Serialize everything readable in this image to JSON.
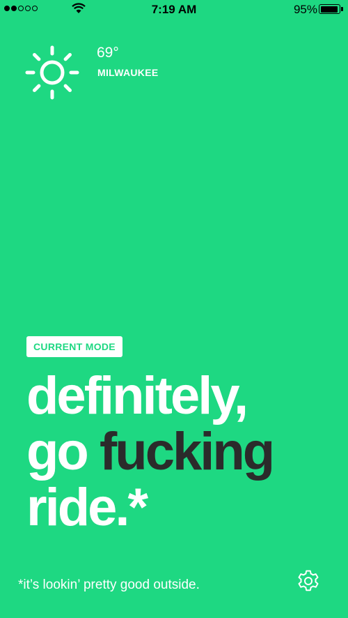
{
  "status_bar": {
    "time": "7:19 AM",
    "battery_percent": "95%",
    "signal_bars_filled": 2,
    "signal_bars_total": 5,
    "battery_level": 0.95
  },
  "weather": {
    "icon": "sun-icon",
    "temperature": "69°",
    "city": "MILWAUKEE"
  },
  "mode": {
    "badge_label": "CURRENT MODE",
    "headline_line1": "definitely,",
    "headline_line2_plain": "go ",
    "headline_line2_emphasis": "fucking",
    "headline_line3": "ride.*"
  },
  "footer": {
    "footnote": "*it’s lookin’ pretty good outside.",
    "settings_icon": "gear-icon"
  },
  "colors": {
    "background": "#1ed882",
    "text_primary": "#ffffff",
    "text_emphasis": "#2b2b2b",
    "status_bar_text": "#000000"
  }
}
